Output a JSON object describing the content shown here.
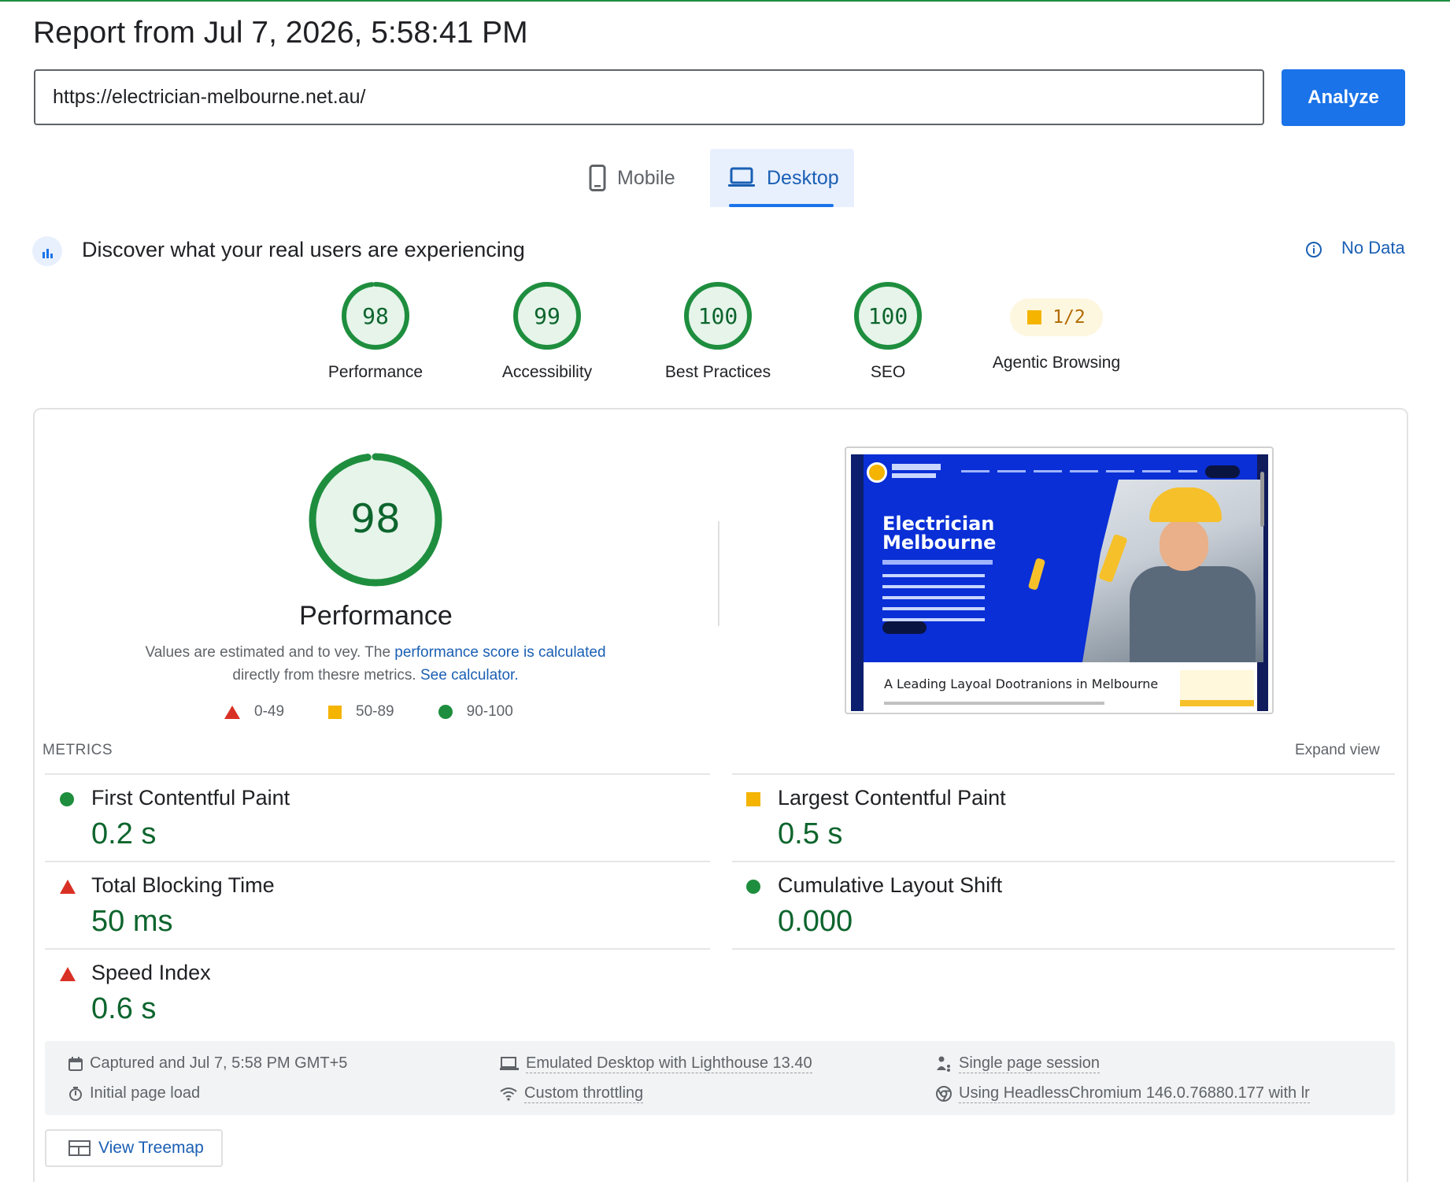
{
  "report": {
    "title": "Report from Jul 7, 2026, 5:58:41 PM"
  },
  "search": {
    "url": "https://electrician-melbourne.net.au/",
    "analyze_label": "Analyze"
  },
  "tabs": [
    {
      "label": "Mobile",
      "icon": "phone-icon",
      "selected": false
    },
    {
      "label": "Desktop",
      "icon": "laptop-icon",
      "selected": true
    }
  ],
  "crux": {
    "text": "Discover what your real users are experiencing",
    "status": "No Data"
  },
  "scores": [
    {
      "label": "Performance",
      "value": "98",
      "score": 98
    },
    {
      "label": "Accessibility",
      "value": "99",
      "score": 99
    },
    {
      "label": "Best Practices",
      "value": "100",
      "score": 100
    },
    {
      "label": "SEO",
      "value": "100",
      "score": 100
    },
    {
      "label": "Agentic Browsing",
      "value": "1/2"
    }
  ],
  "performance": {
    "score": "98",
    "score_fraction": 0.98,
    "title": "Performance",
    "desc_part1": "Values are estimated and to vey. The ",
    "desc_link1": "performance score is calculated",
    "desc_part2": " directly from thesre metrics. ",
    "desc_link2": "See calculator.",
    "legend": [
      "0-49",
      "50-89",
      "90-100"
    ]
  },
  "screenshot": {
    "hero_title_line1": "Electrician",
    "hero_title_line2": "Melbourne",
    "bottom_text": "A Leading Layoal Dootranions in Melbourne"
  },
  "metrics": {
    "header": "METRICS",
    "expand": "Expand view",
    "items": [
      {
        "name": "First Contentful Paint",
        "value": "0.2 s",
        "rating": "pass"
      },
      {
        "name": "Largest Contentful Paint",
        "value": "0.5 s",
        "rating": "average"
      },
      {
        "name": "Total Blocking Time",
        "value": "50 ms",
        "rating": "fail"
      },
      {
        "name": "Cumulative Layout Shift",
        "value": "0.000",
        "rating": "pass"
      },
      {
        "name": "Speed Index",
        "value": "0.6 s",
        "rating": "fail"
      }
    ]
  },
  "footer": {
    "captured": "Captured and Jul 7, 5:58 PM GMT+5",
    "initial_load": "Initial page load",
    "emulated": "Emulated Desktop with Lighthouse 13.40",
    "throttling": "Custom throttling",
    "session": "Single page session",
    "browser": "Using HeadlessChromium 146.0.76880.177 with lr"
  },
  "treemap": {
    "label": "View Treemap"
  },
  "colors": {
    "pass": "#1e8e3e",
    "average": "#f4b400",
    "fail": "#d93025",
    "accent": "#1a73e8"
  }
}
